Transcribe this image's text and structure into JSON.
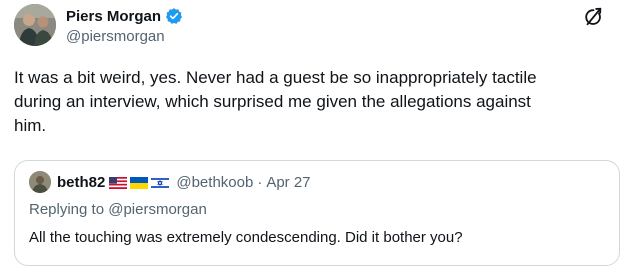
{
  "author": {
    "display_name": "Piers Morgan",
    "handle": "@piersmorgan",
    "verified": true,
    "verified_color": "#1d9bf0"
  },
  "header_icon": "grok-icon",
  "tweet": {
    "lines": [
      "It was a bit weird, yes. Never had a guest be so inappropriately tactile",
      "during an interview, which surprised me given the allegations against",
      "him."
    ]
  },
  "quote": {
    "display_name": "beth82",
    "flags": [
      "us-flag",
      "ukraine-flag",
      "israel-flag"
    ],
    "handle": "@bethkoob",
    "separator": "·",
    "date": "Apr 27",
    "replying_to": "Replying to @piersmorgan",
    "text": "All the touching was extremely condescending. Did it bother you?"
  }
}
